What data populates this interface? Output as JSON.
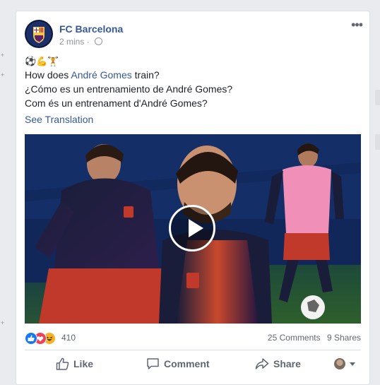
{
  "post": {
    "page_name": "FC Barcelona",
    "time": "2 mins",
    "more_label": "•••",
    "emojis": "⚽💪🏋",
    "line1_prefix": "How does ",
    "line1_link": "André Gomes",
    "line1_suffix": " train?",
    "line2": "¿Cómo es un entrenamiento de André Gomes?",
    "line3": "Com és un entrenament d'André Gomes?",
    "see_translation": "See Translation",
    "reactions_count": "410",
    "comments": "25 Comments",
    "shares": "9 Shares"
  },
  "actions": {
    "like": "Like",
    "comment": "Comment",
    "share": "Share"
  },
  "colors": {
    "link": "#365899",
    "like_blue": "#1877f2",
    "love_red": "#f33e58",
    "haha_yellow": "#f7b125",
    "pink_bib": "#f090b8",
    "kit_navy": "#1a1d3a",
    "kit_red": "#c0392b"
  },
  "icons": [
    "fcb-crest-icon",
    "globe-icon",
    "more-icon",
    "like-reaction-icon",
    "love-reaction-icon",
    "haha-reaction-icon",
    "like-icon",
    "comment-icon",
    "share-icon",
    "play-icon",
    "caret-down-icon"
  ]
}
